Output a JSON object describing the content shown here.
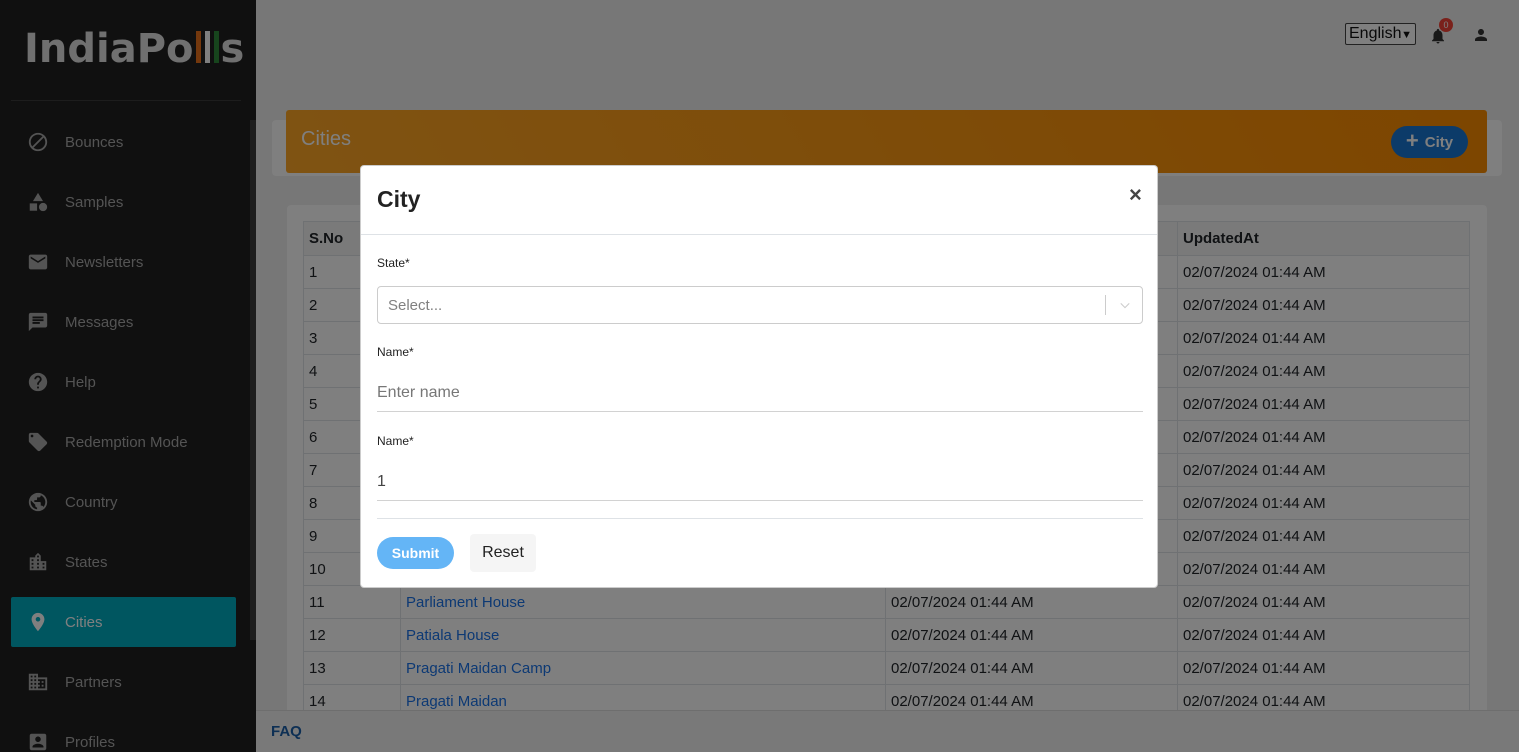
{
  "brand": {
    "logo_text_a": "IndiaPo",
    "logo_text_b": "s",
    "flag_colors": [
      "#e8711a",
      "#ffffff",
      "#2e8b3a"
    ]
  },
  "sidebar": {
    "items": [
      {
        "label": "Bounces",
        "icon": "block-icon",
        "active": false
      },
      {
        "label": "Samples",
        "icon": "shapes-icon",
        "active": false
      },
      {
        "label": "Newsletters",
        "icon": "mail-icon",
        "active": false
      },
      {
        "label": "Messages",
        "icon": "chat-icon",
        "active": false
      },
      {
        "label": "Help",
        "icon": "help-icon",
        "active": false
      },
      {
        "label": "Redemption Mode",
        "icon": "tag-icon",
        "active": false
      },
      {
        "label": "Country",
        "icon": "globe-icon",
        "active": false
      },
      {
        "label": "States",
        "icon": "city-icon",
        "active": false
      },
      {
        "label": "Cities",
        "icon": "location-pin-icon",
        "active": true
      },
      {
        "label": "Partners",
        "icon": "building-icon",
        "active": false
      },
      {
        "label": "Profiles",
        "icon": "profile-icon",
        "active": false
      }
    ]
  },
  "topbar": {
    "language": "English",
    "notifications_count": "0"
  },
  "page": {
    "title": "Cities",
    "add_button_label": "City"
  },
  "table": {
    "headers": [
      "S.No",
      "",
      "",
      "UpdatedAt"
    ],
    "rows": [
      {
        "sno": "1",
        "name": "",
        "created": "",
        "updated": "02/07/2024 01:44 AM"
      },
      {
        "sno": "2",
        "name": "",
        "created": "",
        "updated": "02/07/2024 01:44 AM"
      },
      {
        "sno": "3",
        "name": "",
        "created": "",
        "updated": "02/07/2024 01:44 AM"
      },
      {
        "sno": "4",
        "name": "",
        "created": "",
        "updated": "02/07/2024 01:44 AM"
      },
      {
        "sno": "5",
        "name": "",
        "created": "",
        "updated": "02/07/2024 01:44 AM"
      },
      {
        "sno": "6",
        "name": "",
        "created": "",
        "updated": "02/07/2024 01:44 AM"
      },
      {
        "sno": "7",
        "name": "",
        "created": "",
        "updated": "02/07/2024 01:44 AM"
      },
      {
        "sno": "8",
        "name": "",
        "created": "",
        "updated": "02/07/2024 01:44 AM"
      },
      {
        "sno": "9",
        "name": "",
        "created": "",
        "updated": "02/07/2024 01:44 AM"
      },
      {
        "sno": "10",
        "name": "",
        "created": "",
        "updated": "02/07/2024 01:44 AM"
      },
      {
        "sno": "11",
        "name": "Parliament House",
        "created": "02/07/2024 01:44 AM",
        "updated": "02/07/2024 01:44 AM"
      },
      {
        "sno": "12",
        "name": "Patiala House",
        "created": "02/07/2024 01:44 AM",
        "updated": "02/07/2024 01:44 AM"
      },
      {
        "sno": "13",
        "name": "Pragati Maidan Camp",
        "created": "02/07/2024 01:44 AM",
        "updated": "02/07/2024 01:44 AM"
      },
      {
        "sno": "14",
        "name": "Pragati Maidan",
        "created": "02/07/2024 01:44 AM",
        "updated": "02/07/2024 01:44 AM"
      }
    ]
  },
  "footer": {
    "faq": "FAQ"
  },
  "modal": {
    "title": "City",
    "close": "×",
    "state_label": "State*",
    "state_placeholder": "Select...",
    "name_label": "Name*",
    "name_placeholder": "Enter name",
    "name2_label": "Name*",
    "name2_value": "1",
    "submit_label": "Submit",
    "reset_label": "Reset"
  }
}
